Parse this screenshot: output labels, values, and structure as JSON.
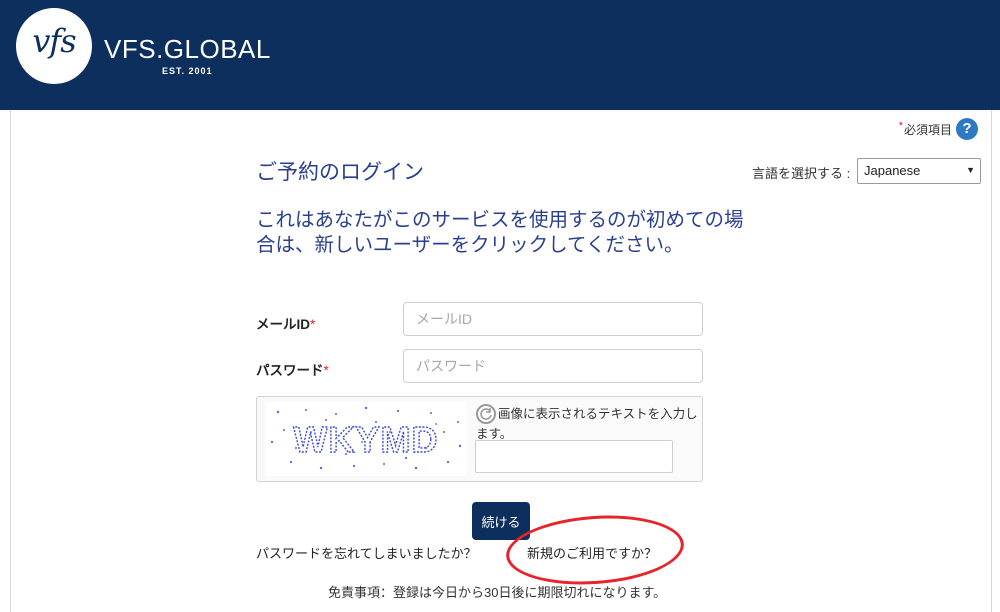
{
  "header": {
    "logo_mark": "vfs",
    "brand_name": "VFS.GLOBAL",
    "established": "EST. 2001",
    "background_color": "#0d2f5d"
  },
  "required_note": {
    "asterisk": "*",
    "label": "必須項目",
    "help_icon": "?"
  },
  "page_title": "ご予約のログイン",
  "language": {
    "label": "言語を選択する :",
    "selected": "Japanese"
  },
  "intro_text": "これはあなたがこのサービスを使用するのが初めての場合は、新しいユーザーをクリックしてください。",
  "form": {
    "email": {
      "label": "メールID",
      "required_mark": "*",
      "placeholder": "メールID"
    },
    "password": {
      "label": "パスワード",
      "required_mark": "*",
      "placeholder": "パスワード"
    },
    "captcha": {
      "image_text": "WKYMD",
      "refresh_icon": "refresh-icon",
      "instruction": "画像に表示されるテキストを入力します。",
      "value": ""
    },
    "continue_label": "続ける"
  },
  "links": {
    "forgot_password": "パスワードを忘れてしまいましたか？",
    "new_user": "新規のご利用ですか？"
  },
  "disclaimer": "免責事項：登録は今日から30日後に期限切れになります。",
  "accent_colors": {
    "title_blue": "#2a3f8f",
    "required_red": "#e0262a",
    "annotation_red": "#e8232a"
  }
}
